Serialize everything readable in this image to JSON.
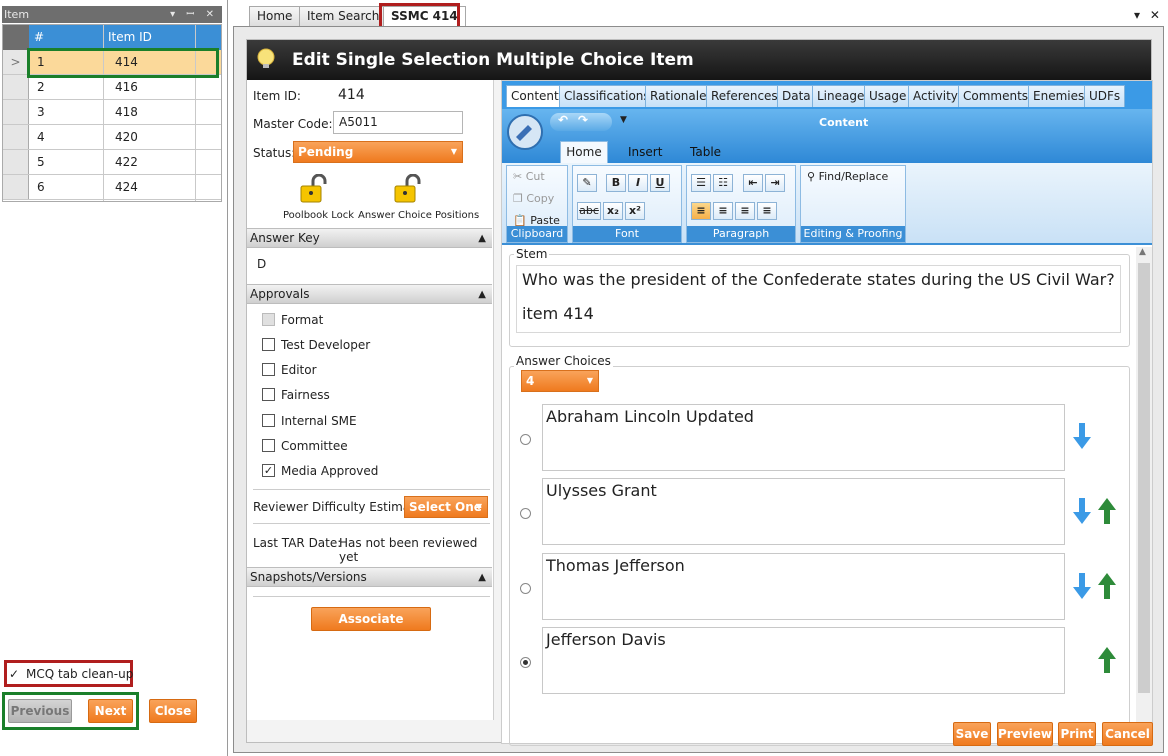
{
  "left_panel": {
    "title": "Item",
    "controls": "▾ ꟷ ✕",
    "grid": {
      "headers": [
        "#",
        "Item ID"
      ],
      "rows": [
        {
          "num": "1",
          "id": "414",
          "selected": true
        },
        {
          "num": "2",
          "id": "416"
        },
        {
          "num": "3",
          "id": "418"
        },
        {
          "num": "4",
          "id": "420"
        },
        {
          "num": "5",
          "id": "422"
        },
        {
          "num": "6",
          "id": "424"
        }
      ],
      "row_indicator": ">"
    },
    "checkbox_label": "MCQ tab clean-up",
    "checkbox_mark": "✓",
    "buttons": {
      "previous": "Previous",
      "next": "Next",
      "close": "Close"
    }
  },
  "doc_tabs": [
    "Home",
    "Item Search",
    "SSMC 414"
  ],
  "window_controls": "▾ ✕",
  "editor": {
    "title": "Edit Single Selection Multiple Choice Item",
    "item_id_label": "Item ID:",
    "item_id_value": "414",
    "master_code_label": "Master Code:",
    "master_code_value": "A5011",
    "status_label": "Status:",
    "status_value": "Pending",
    "poolbook_lock": "Poolbook Lock",
    "answer_choice_positions": "Answer Choice Positions",
    "answer_key_header": "Answer Key",
    "answer_key_value": "D",
    "approvals_header": "Approvals",
    "approvals": [
      {
        "label": "Format",
        "checked": false,
        "disabled": true
      },
      {
        "label": "Test Developer",
        "checked": false
      },
      {
        "label": "Editor",
        "checked": false
      },
      {
        "label": "Fairness",
        "checked": false
      },
      {
        "label": "Internal SME",
        "checked": false
      },
      {
        "label": "Committee",
        "checked": false
      },
      {
        "label": "Media Approved",
        "checked": true
      }
    ],
    "reviewer_difficulty_label": "Reviewer Difficulty Estimate",
    "reviewer_difficulty_value": "Select One",
    "last_tar_label": "Last TAR Date:",
    "last_tar_value": "Has not been reviewed yet",
    "snapshots_header": "Snapshots/Versions",
    "associate_passage": "Associate Passage"
  },
  "content_tabs": [
    "Content",
    "Classifications",
    "Rationale",
    "References",
    "Data",
    "Lineage",
    "Usage",
    "Activity",
    "Comments",
    "Enemies",
    "UDFs"
  ],
  "ribbon": {
    "title": "Content",
    "tabs": [
      "Home",
      "Insert",
      "Table"
    ],
    "clipboard": {
      "cut": "Cut",
      "copy": "Copy",
      "paste": "Paste",
      "caption": "Clipboard"
    },
    "font_caption": "Font",
    "paragraph_caption": "Paragraph",
    "editing": {
      "find_replace": "Find/Replace",
      "caption": "Editing & Proofing"
    }
  },
  "stem": {
    "legend": "Stem",
    "line1": "Who was the president of the Confederate states during the US Civil War?",
    "line2": "item 414"
  },
  "answer_choices": {
    "legend": "Answer Choices",
    "count": "4",
    "choices": [
      {
        "text": "Abraham Lincoln Updated",
        "selected": false
      },
      {
        "text": "Ulysses Grant",
        "selected": false
      },
      {
        "text": "Thomas Jefferson",
        "selected": false
      },
      {
        "text": "Jefferson Davis",
        "selected": true
      }
    ]
  },
  "footer_buttons": {
    "save": "Save",
    "preview": "Preview",
    "print": "Print",
    "cancel": "Cancel"
  },
  "colors": {
    "accent_orange": "#ef7a1e",
    "accent_blue": "#3b8fd6",
    "highlight_green": "#1a7f2a",
    "highlight_red": "#b01e1e"
  }
}
